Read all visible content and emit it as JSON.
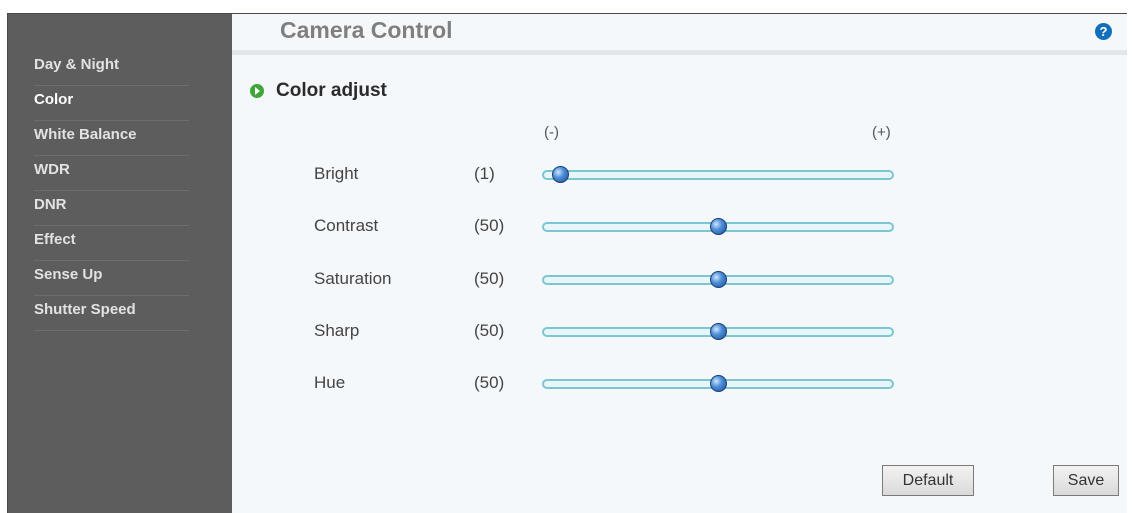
{
  "title": "Camera Control",
  "help_icon": "?",
  "sidebar": {
    "items": [
      {
        "label": "Day & Night"
      },
      {
        "label": "Color"
      },
      {
        "label": "White Balance"
      },
      {
        "label": "WDR"
      },
      {
        "label": "DNR"
      },
      {
        "label": "Effect"
      },
      {
        "label": "Sense Up"
      },
      {
        "label": "Shutter Speed"
      }
    ]
  },
  "section": {
    "title": "Color adjust"
  },
  "scale": {
    "min_label": "(-)",
    "max_label": "(+)"
  },
  "sliders": [
    {
      "label": "Bright",
      "value_text": "(1)",
      "level": 0.0
    },
    {
      "label": "Contrast",
      "value_text": "(50)",
      "level": 0.5
    },
    {
      "label": "Saturation",
      "value_text": "(50)",
      "level": 0.5
    },
    {
      "label": "Sharp",
      "value_text": "(50)",
      "level": 0.5
    },
    {
      "label": "Hue",
      "value_text": "(50)",
      "level": 0.5
    }
  ],
  "buttons": {
    "default": "Default",
    "save": "Save"
  },
  "colors": {
    "sidebar": "#5d5d5d",
    "accent": "#3fa73a",
    "track": "#7cc6d3"
  }
}
